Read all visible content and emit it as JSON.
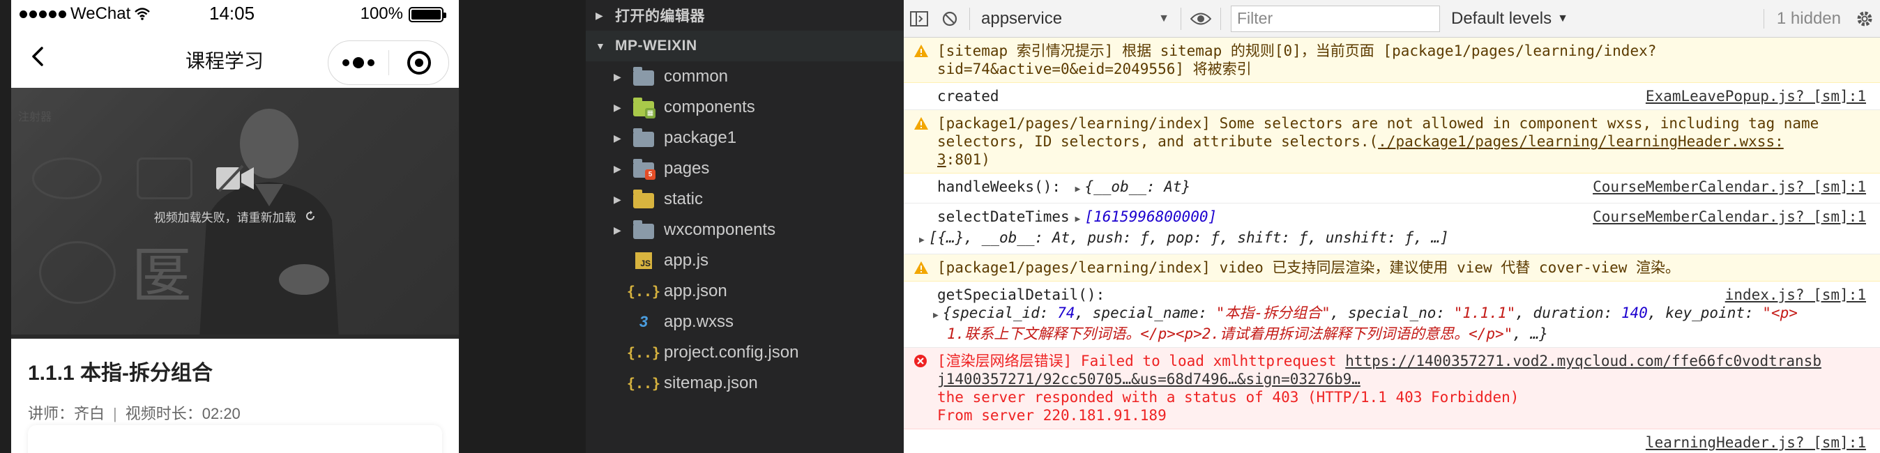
{
  "phone": {
    "status": {
      "carrier": "WeChat",
      "time": "14:05",
      "battery": "100%"
    },
    "nav_title": "课程学习",
    "video": {
      "error_text": "视频加载失败，请重新加载",
      "bg_char": "匽",
      "bg_tag": "注射器"
    },
    "course": {
      "title": "1.1.1 本指-拆分组合",
      "teacher": "讲师：齐白",
      "divider": "|",
      "duration": "视频时长：02:20"
    }
  },
  "explorer": {
    "open_editors": "打开的编辑器",
    "project": "MP-WEIXIN",
    "items": [
      {
        "name": "common",
        "kind": "folder",
        "color": "gray"
      },
      {
        "name": "components",
        "kind": "folder",
        "color": "green"
      },
      {
        "name": "package1",
        "kind": "folder",
        "color": "gray"
      },
      {
        "name": "pages",
        "kind": "folder",
        "color": "gray",
        "badge": "red"
      },
      {
        "name": "static",
        "kind": "folder",
        "color": "yellow"
      },
      {
        "name": "wxcomponents",
        "kind": "folder",
        "color": "gray"
      },
      {
        "name": "app.js",
        "kind": "js"
      },
      {
        "name": "app.json",
        "kind": "json"
      },
      {
        "name": "app.wxss",
        "kind": "css"
      },
      {
        "name": "project.config.json",
        "kind": "json"
      },
      {
        "name": "sitemap.json",
        "kind": "json"
      }
    ]
  },
  "console": {
    "context": "appservice",
    "filter_placeholder": "Filter",
    "levels": "Default levels",
    "hidden": "1 hidden",
    "messages": {
      "m1": {
        "l1": "[sitemap 索引情况提示] 根据 sitemap 的规则[0]，当前页面 [package1/pages/learning/index?",
        "l2": "sid=74&active=0&eid=2049556] 将被索引"
      },
      "m2": {
        "text": "created",
        "src": "ExamLeavePopup.js? [sm]:1"
      },
      "m3": {
        "l1": "[package1/pages/learning/index] Some selectors are not allowed in component wxss, including tag name",
        "l2a": "selectors, ID selectors, and attribute selectors.(",
        "l2link": "./package1/pages/learning/learningHeader.wxss:",
        "l3link": "3",
        "l3": ":801)"
      },
      "m4": {
        "label": "handleWeeks():",
        "obj": "{__ob__: At}",
        "src": "CourseMemberCalendar.js? [sm]:1"
      },
      "m5": {
        "label": "selectDateTimes",
        "arr": "[1615996800000]",
        "detail": "[{…}, __ob__: At, push: ƒ, pop: ƒ, shift: ƒ, unshift: ƒ, …]",
        "src": "CourseMemberCalendar.js? [sm]:1"
      },
      "m6": {
        "text": "[package1/pages/learning/index] video 已支持同层渲染，建议使用 view 代替 cover-view 渲染。"
      },
      "m7": {
        "label": "getSpecialDetail():",
        "src": "index.js? [sm]:1",
        "k1": "special_id: ",
        "v1": "74",
        "k2": ", special_name: ",
        "v2": "\"本指-拆分组合\"",
        "k3": ", special_no: ",
        "v3": "\"1.1.1\"",
        "k4": ", duration: ",
        "v4": "140",
        "k5": ", key_point: ",
        "v5": "\"<p>",
        "l2": "1.联系上下文解释下列词语。</p><p>2.请试着用拆词法解释下列词语的意思。</p>\"",
        "l2tail": ", …}"
      },
      "m8": {
        "l1a": "[渲染层网络层错误] Failed to load xmlhttprequest ",
        "l1link": "https://1400357271.vod2.myqcloud.com/ffe66fc0vodtransb",
        "l2link": "j1400357271/92cc50705…&us=68d7496…&sign=03276b9…",
        "l3": "the server responded with a status of 403 (HTTP/1.1 403 Forbidden)",
        "l4": "From server 220.181.91.189"
      },
      "m9": {
        "src": "learningHeader.js? [sm]:1"
      }
    }
  },
  "colors": {
    "warn_bg": "#fffbe5",
    "err_bg": "#fff0f0",
    "explorer_bg": "#252526",
    "console_bg": "#ffffff"
  }
}
